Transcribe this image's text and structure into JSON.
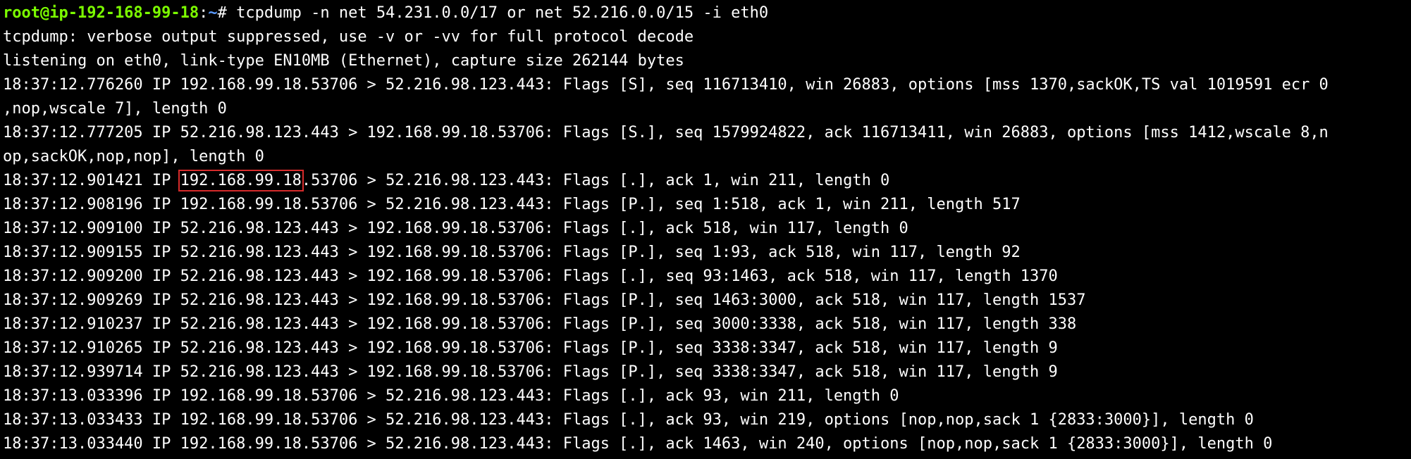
{
  "prompt": {
    "user_host": "root@ip-192-168-99-18",
    "separator": ":",
    "path": "~",
    "symbol": "# ",
    "command": "tcpdump -n net 54.231.0.0/17 or net 52.216.0.0/15 -i eth0"
  },
  "header_lines": [
    "tcpdump: verbose output suppressed, use -v or -vv for full protocol decode",
    "listening on eth0, link-type EN10MB (Ethernet), capture size 262144 bytes"
  ],
  "packets": {
    "p1_line1": "18:37:12.776260 IP 192.168.99.18.53706 > 52.216.98.123.443: Flags [S], seq 116713410, win 26883, options [mss 1370,sackOK,TS val 1019591 ecr 0",
    "p1_line2": ",nop,wscale 7], length 0",
    "p2_line1": "18:37:12.777205 IP 52.216.98.123.443 > 192.168.99.18.53706: Flags [S.], seq 1579924822, ack 116713411, win 26883, options [mss 1412,wscale 8,n",
    "p2_line2": "op,sackOK,nop,nop], length 0",
    "p3_prefix": "18:37:12.901421 IP ",
    "p3_highlight": "192.168.99.18",
    "p3_suffix": ".53706 > 52.216.98.123.443: Flags [.], ack 1, win 211, length 0",
    "rows": [
      "18:37:12.908196 IP 192.168.99.18.53706 > 52.216.98.123.443: Flags [P.], seq 1:518, ack 1, win 211, length 517",
      "18:37:12.909100 IP 52.216.98.123.443 > 192.168.99.18.53706: Flags [.], ack 518, win 117, length 0",
      "18:37:12.909155 IP 52.216.98.123.443 > 192.168.99.18.53706: Flags [P.], seq 1:93, ack 518, win 117, length 92",
      "18:37:12.909200 IP 52.216.98.123.443 > 192.168.99.18.53706: Flags [.], seq 93:1463, ack 518, win 117, length 1370",
      "18:37:12.909269 IP 52.216.98.123.443 > 192.168.99.18.53706: Flags [P.], seq 1463:3000, ack 518, win 117, length 1537",
      "18:37:12.910237 IP 52.216.98.123.443 > 192.168.99.18.53706: Flags [P.], seq 3000:3338, ack 518, win 117, length 338",
      "18:37:12.910265 IP 52.216.98.123.443 > 192.168.99.18.53706: Flags [P.], seq 3338:3347, ack 518, win 117, length 9",
      "18:37:12.939714 IP 52.216.98.123.443 > 192.168.99.18.53706: Flags [P.], seq 3338:3347, ack 518, win 117, length 9",
      "18:37:13.033396 IP 192.168.99.18.53706 > 52.216.98.123.443: Flags [.], ack 93, win 211, length 0",
      "18:37:13.033433 IP 192.168.99.18.53706 > 52.216.98.123.443: Flags [.], ack 93, win 219, options [nop,nop,sack 1 {2833:3000}], length 0",
      "18:37:13.033440 IP 192.168.99.18.53706 > 52.216.98.123.443: Flags [.], ack 1463, win 240, options [nop,nop,sack 1 {2833:3000}], length 0"
    ]
  },
  "colors": {
    "background": "#000000",
    "text": "#ffffff",
    "prompt_user": "#7CFC00",
    "prompt_path": "#5A9BFF",
    "highlight_box": "#d62b2b"
  }
}
